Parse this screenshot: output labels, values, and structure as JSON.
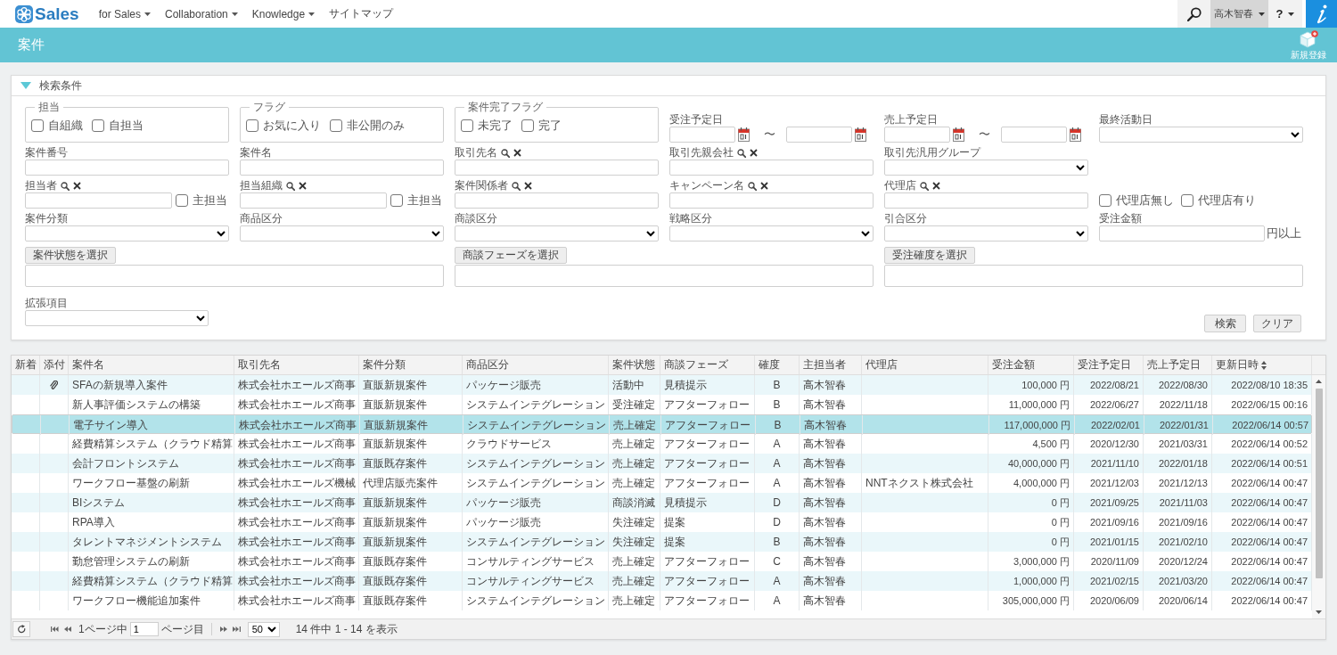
{
  "nav": {
    "logo": "Sales",
    "menu": [
      {
        "label": "for Sales",
        "dropdown": true
      },
      {
        "label": "Collaboration",
        "dropdown": true
      },
      {
        "label": "Knowledge",
        "dropdown": true
      },
      {
        "label": "サイトマップ",
        "dropdown": false
      }
    ],
    "user": "高木智春",
    "help": "?"
  },
  "header": {
    "title": "案件",
    "new_button": "新規登録"
  },
  "search": {
    "title": "検索条件",
    "expanded": true,
    "rows": [
      [
        {
          "kind": "group",
          "legend": "担当",
          "options": [
            {
              "label": "自組織",
              "checked": false
            },
            {
              "label": "自担当",
              "checked": false
            }
          ]
        },
        {
          "kind": "group",
          "legend": "フラグ",
          "options": [
            {
              "label": "お気に入り",
              "checked": false
            },
            {
              "label": "非公開のみ",
              "checked": false
            }
          ]
        },
        {
          "kind": "group",
          "legend": "案件完了フラグ",
          "options": [
            {
              "label": "未完了",
              "checked": false
            },
            {
              "label": "完了",
              "checked": false
            }
          ]
        },
        {
          "kind": "date_range",
          "label": "受注予定日",
          "separator": "〜"
        },
        {
          "kind": "date_range",
          "label": "売上予定日",
          "separator": "〜"
        },
        {
          "kind": "select",
          "label": "最終活動日"
        }
      ],
      [
        {
          "kind": "text",
          "label": "案件番号"
        },
        {
          "kind": "text",
          "label": "案件名"
        },
        {
          "kind": "lookup",
          "label": "取引先名"
        },
        {
          "kind": "lookup",
          "label": "取引先親会社"
        },
        {
          "kind": "select",
          "label": "取引先汎用グループ"
        }
      ],
      [
        {
          "kind": "lookup",
          "label": "担当者",
          "option": {
            "label": "主担当",
            "checked": false
          }
        },
        {
          "kind": "lookup",
          "label": "担当組織",
          "option": {
            "label": "主担当",
            "checked": false
          }
        },
        {
          "kind": "lookup",
          "label": "案件関係者"
        },
        {
          "kind": "lookup",
          "label": "キャンペーン名"
        },
        {
          "kind": "lookup",
          "label": "代理店"
        },
        {
          "kind": "checks",
          "options": [
            {
              "label": "代理店無し",
              "checked": false
            },
            {
              "label": "代理店有り",
              "checked": false
            }
          ]
        }
      ],
      [
        {
          "kind": "select",
          "label": "案件分類"
        },
        {
          "kind": "select",
          "label": "商品区分"
        },
        {
          "kind": "select",
          "label": "商談区分"
        },
        {
          "kind": "select",
          "label": "戦略区分"
        },
        {
          "kind": "select",
          "label": "引合区分"
        },
        {
          "kind": "amount",
          "label": "受注金額",
          "suffix": "円以上"
        }
      ],
      [
        {
          "kind": "picker",
          "button": "案件状態を選択",
          "colspan": 2
        },
        {
          "kind": "picker",
          "button": "商談フェーズを選択",
          "colspan": 2
        },
        {
          "kind": "picker",
          "button": "受注確度を選択",
          "colspan": 2
        }
      ],
      [
        {
          "kind": "select",
          "label": "拡張項目"
        }
      ]
    ],
    "buttons": [
      "検索",
      "クリア"
    ]
  },
  "table": {
    "columns": [
      {
        "label": "新着",
        "sorted": false
      },
      {
        "label": "添付",
        "sorted": false
      },
      {
        "label": "案件名",
        "sorted": false
      },
      {
        "label": "取引先名",
        "sorted": false
      },
      {
        "label": "案件分類",
        "sorted": false
      },
      {
        "label": "商品区分",
        "sorted": false
      },
      {
        "label": "案件状態",
        "sorted": false
      },
      {
        "label": "商談フェーズ",
        "sorted": false
      },
      {
        "label": "確度",
        "sorted": false
      },
      {
        "label": "主担当者",
        "sorted": false
      },
      {
        "label": "代理店",
        "sorted": false
      },
      {
        "label": "受注金額",
        "sorted": false
      },
      {
        "label": "受注予定日",
        "sorted": false
      },
      {
        "label": "売上予定日",
        "sorted": false
      },
      {
        "label": "更新日時",
        "sorted": true
      }
    ],
    "rows": [
      {
        "attachment": true,
        "selected": false,
        "name": "SFAの新規導入案件",
        "client": "株式会社ホエールズ商事",
        "category": "直販新規案件",
        "product": "パッケージ販売",
        "status": "活動中",
        "phase": "見積提示",
        "rank": "B",
        "owner": "高木智春",
        "amount": "100,000 円",
        "order_date": "2022/08/21",
        "sales_date": "2022/08/30",
        "updated": "2022/08/10 18:35"
      },
      {
        "attachment": false,
        "selected": false,
        "name": "新人事評価システムの構築",
        "client": "株式会社ホエールズ商事",
        "category": "直販新規案件",
        "product": "システムインテグレーション",
        "status": "受注確定",
        "phase": "アフターフォロー",
        "rank": "B",
        "owner": "高木智春",
        "amount": "11,000,000 円",
        "order_date": "2022/06/27",
        "sales_date": "2022/11/18",
        "updated": "2022/06/15 00:16"
      },
      {
        "attachment": false,
        "selected": true,
        "name": "電子サイン導入",
        "client": "株式会社ホエールズ商事",
        "category": "直販新規案件",
        "product": "システムインテグレーション",
        "status": "売上確定",
        "phase": "アフターフォロー",
        "rank": "B",
        "owner": "高木智春",
        "amount": "117,000,000 円",
        "order_date": "2022/02/01",
        "sales_date": "2022/01/31",
        "updated": "2022/06/14 00:57"
      },
      {
        "attachment": false,
        "selected": false,
        "name": "経費精算システム（クラウド精算",
        "client": "株式会社ホエールズ商事",
        "category": "直販新規案件",
        "product": "クラウドサービス",
        "status": "売上確定",
        "phase": "アフターフォロー",
        "rank": "A",
        "owner": "高木智春",
        "amount": "4,500 円",
        "order_date": "2020/12/30",
        "sales_date": "2021/03/31",
        "updated": "2022/06/14 00:52"
      },
      {
        "attachment": false,
        "selected": false,
        "name": "会計フロントシステム",
        "client": "株式会社ホエールズ商事",
        "category": "直販既存案件",
        "product": "システムインテグレーション",
        "status": "売上確定",
        "phase": "アフターフォロー",
        "rank": "A",
        "owner": "高木智春",
        "amount": "40,000,000 円",
        "order_date": "2021/11/10",
        "sales_date": "2022/01/18",
        "updated": "2022/06/14 00:51"
      },
      {
        "attachment": false,
        "selected": false,
        "name": "ワークフロー基盤の刷新",
        "client": "株式会社ホエールズ機械",
        "category": "代理店販売案件",
        "product": "システムインテグレーション",
        "status": "売上確定",
        "phase": "アフターフォロー",
        "rank": "A",
        "owner": "高木智春",
        "agency": "NNTネクスト株式会社",
        "amount": "4,000,000 円",
        "order_date": "2021/12/03",
        "sales_date": "2021/12/13",
        "updated": "2022/06/14 00:47"
      },
      {
        "attachment": false,
        "selected": false,
        "name": "BIシステム",
        "client": "株式会社ホエールズ商事",
        "category": "直販新規案件",
        "product": "パッケージ販売",
        "status": "商談消滅",
        "phase": "見積提示",
        "rank": "D",
        "owner": "高木智春",
        "amount": "0 円",
        "order_date": "2021/09/25",
        "sales_date": "2021/11/03",
        "updated": "2022/06/14 00:47"
      },
      {
        "attachment": false,
        "selected": false,
        "name": "RPA導入",
        "client": "株式会社ホエールズ商事",
        "category": "直販新規案件",
        "product": "パッケージ販売",
        "status": "失注確定",
        "phase": "提案",
        "rank": "D",
        "owner": "高木智春",
        "amount": "0 円",
        "order_date": "2021/09/16",
        "sales_date": "2021/09/16",
        "updated": "2022/06/14 00:47"
      },
      {
        "attachment": false,
        "selected": false,
        "name": "タレントマネジメントシステム",
        "client": "株式会社ホエールズ商事",
        "category": "直販新規案件",
        "product": "システムインテグレーション",
        "status": "失注確定",
        "phase": "提案",
        "rank": "B",
        "owner": "高木智春",
        "amount": "0 円",
        "order_date": "2021/01/15",
        "sales_date": "2021/02/10",
        "updated": "2022/06/14 00:47"
      },
      {
        "attachment": false,
        "selected": false,
        "name": "勤怠管理システムの刷新",
        "client": "株式会社ホエールズ商事",
        "category": "直販既存案件",
        "product": "コンサルティングサービス",
        "status": "売上確定",
        "phase": "アフターフォロー",
        "rank": "C",
        "owner": "高木智春",
        "amount": "3,000,000 円",
        "order_date": "2020/11/09",
        "sales_date": "2020/12/24",
        "updated": "2022/06/14 00:47"
      },
      {
        "attachment": false,
        "selected": false,
        "name": "経費精算システム（クラウド精算",
        "client": "株式会社ホエールズ商事",
        "category": "直販既存案件",
        "product": "コンサルティングサービス",
        "status": "売上確定",
        "phase": "アフターフォロー",
        "rank": "A",
        "owner": "高木智春",
        "amount": "1,000,000 円",
        "order_date": "2021/02/15",
        "sales_date": "2021/03/20",
        "updated": "2022/06/14 00:47"
      },
      {
        "attachment": false,
        "selected": false,
        "name": "ワークフロー機能追加案件",
        "client": "株式会社ホエールズ商事",
        "category": "直販既存案件",
        "product": "システムインテグレーション",
        "status": "売上確定",
        "phase": "アフターフォロー",
        "rank": "A",
        "owner": "高木智春",
        "amount": "305,000,000 円",
        "order_date": "2020/06/09",
        "sales_date": "2020/06/14",
        "updated": "2022/06/14 00:47"
      }
    ]
  },
  "pager": {
    "page_prefix": "1ページ中",
    "page": "1",
    "page_suffix": "ページ目",
    "page_size": "50",
    "summary": "14 件中 1 - 14 を表示"
  }
}
